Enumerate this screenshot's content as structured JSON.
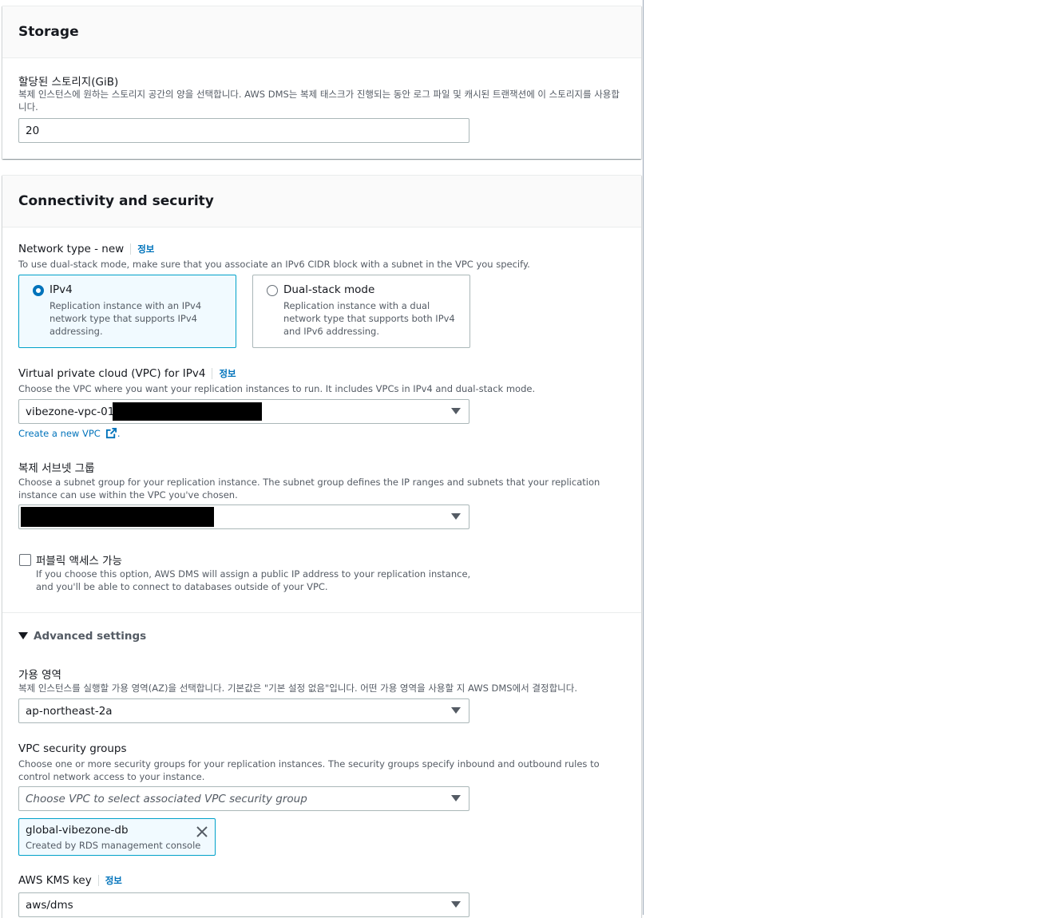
{
  "storage": {
    "title": "Storage",
    "allocated_label": "할당된 스토리지(GiB)",
    "allocated_desc": "복제 인스턴스에 원하는 스토리지 공간의 양을 선택합니다. AWS DMS는 복제 태스크가 진행되는 동안 로그 파일 및 캐시된 트랜잭션에 이 스토리지를 사용합니다.",
    "allocated_value": "20"
  },
  "connectivity": {
    "title": "Connectivity and security",
    "network_type_label": "Network type - new",
    "info_label": "정보",
    "network_type_desc": "To use dual-stack mode, make sure that you associate an IPv6 CIDR block with a subnet in the VPC you specify.",
    "options": [
      {
        "title": "IPv4",
        "desc": "Replication instance with an IPv4 network type that supports IPv4 addressing.",
        "selected": true
      },
      {
        "title": "Dual-stack mode",
        "desc": "Replication instance with a dual network type that supports both IPv4 and IPv6 addressing.",
        "selected": false
      }
    ],
    "vpc_label": "Virtual private cloud (VPC) for IPv4",
    "vpc_desc": "Choose the VPC where you want your replication instances to run. It includes VPCs in IPv4 and dual-stack mode.",
    "vpc_value": "vibezone-vpc-01",
    "create_vpc_link": "Create a new VPC",
    "subnet_label": "복제 서브넷 그룹",
    "subnet_desc": "Choose a subnet group for your replication instance. The subnet group defines the IP ranges and subnets that your replication instance can use within the VPC you've chosen.",
    "public_access_label": "퍼블릭 액세스 가능",
    "public_access_desc": "If you choose this option, AWS DMS will assign a public IP address to your replication instance, and you'll be able to connect to databases outside of your VPC.",
    "public_access_checked": false
  },
  "advanced": {
    "toggle_label": "Advanced settings",
    "az_label": "가용 영역",
    "az_desc": "복제 인스턴스를 실행할 가용 영역(AZ)을 선택합니다. 기본값은 \"기본 설정 없음\"입니다. 어떤 가용 영역을 사용할 지 AWS DMS에서 결정합니다.",
    "az_value": "ap-northeast-2a",
    "sg_label": "VPC security groups",
    "sg_desc": "Choose one or more security groups for your replication instances. The security groups specify inbound and outbound rules to control network access to your instance.",
    "sg_placeholder": "Choose VPC to select associated VPC security group",
    "sg_token_name": "global-vibezone-db",
    "sg_token_desc": "Created by RDS management console",
    "kms_label": "AWS KMS key",
    "kms_value": "aws/dms"
  },
  "colors": {
    "accent": "#0073bb",
    "selected_border": "#00a1c9",
    "selected_bg": "#f1faff"
  }
}
